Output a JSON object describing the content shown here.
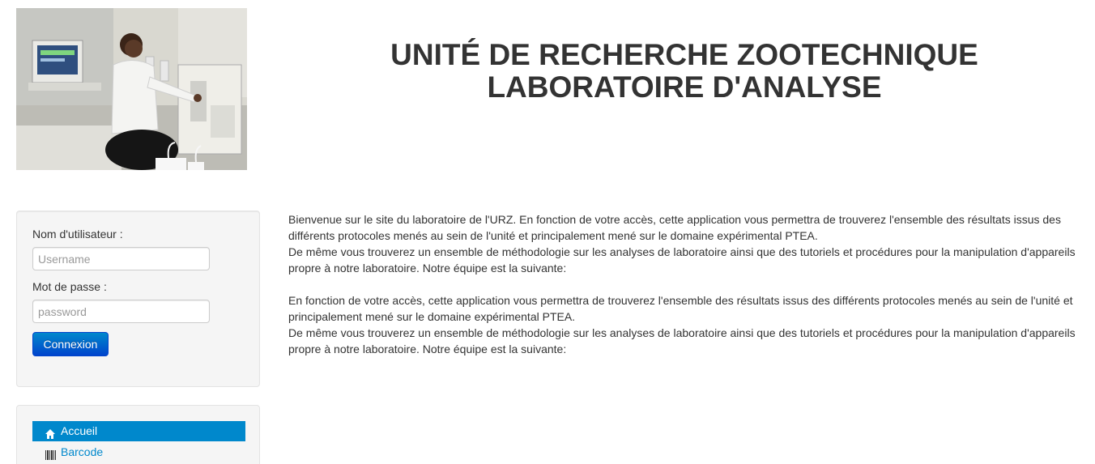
{
  "colors": {
    "accent": "#0088cc",
    "button_top": "#0088cc",
    "button_bottom": "#0044cc",
    "text": "#333333",
    "well_background": "#f5f5f5"
  },
  "header": {
    "title_line1": "UNITÉ DE RECHERCHE ZOOTECHNIQUE",
    "title_line2": "LABORATOIRE D'ANALYSE"
  },
  "login": {
    "username_label": "Nom d'utilisateur :",
    "username_placeholder": "Username",
    "username_value": "",
    "password_label": "Mot de passe :",
    "password_placeholder": "password",
    "password_value": "",
    "submit_label": "Connexion"
  },
  "nav": {
    "items": [
      {
        "label": "Accueil",
        "icon": "home-icon",
        "active": true
      },
      {
        "label": "Barcode",
        "icon": "barcode-icon",
        "active": false
      }
    ]
  },
  "content": {
    "paragraph1_line1": "Bienvenue sur le site du laboratoire de l'URZ. En fonction de votre accès, cette application vous permettra de trouverez l'ensemble des résultats issus des différents protocoles menés au sein de l'unité et principalement mené sur le domaine expérimental PTEA.",
    "paragraph1_line2": "De même vous trouverez un ensemble de méthodologie sur les analyses de laboratoire ainsi que des tutoriels et procédures pour la manipulation d'appareils propre à notre laboratoire. Notre équipe est la suivante:",
    "paragraph2_line1": "En fonction de votre accès, cette application vous permettra de trouverez l'ensemble des résultats issus des différents protocoles menés au sein de l'unité et principalement mené sur le domaine expérimental PTEA.",
    "paragraph2_line2": "De même vous trouverez un ensemble de méthodologie sur les analyses de laboratoire ainsi que des tutoriels et procédures pour la manipulation d'appareils propre à notre laboratoire. Notre équipe est la suivante:"
  }
}
